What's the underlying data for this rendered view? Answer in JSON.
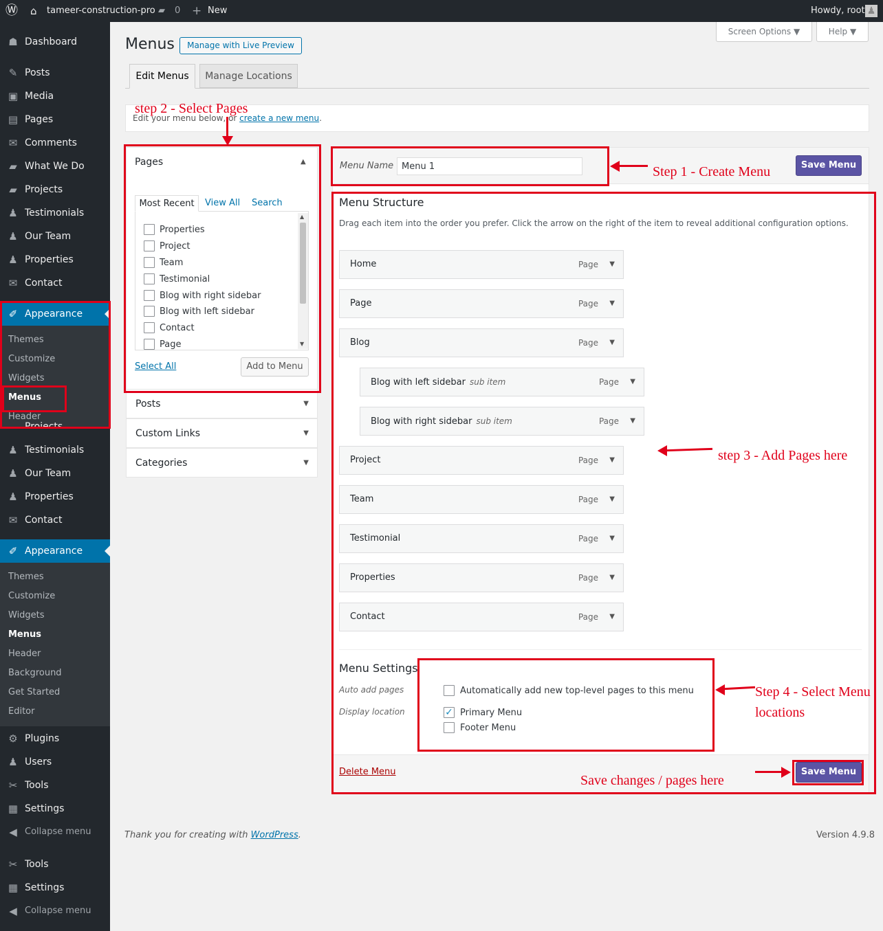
{
  "adminbar": {
    "site": "tameer-construction-pro",
    "comments": "0",
    "new": "New",
    "howdy": "Howdy, root"
  },
  "sidebar": {
    "top": [
      {
        "icon": "☗",
        "label": "Dashboard"
      },
      {
        "icon": "✎",
        "label": "Posts"
      },
      {
        "icon": "▣",
        "label": "Media"
      },
      {
        "icon": "▤",
        "label": "Pages"
      },
      {
        "icon": "✉",
        "label": "Comments"
      },
      {
        "icon": "▰",
        "label": "What We Do"
      },
      {
        "icon": "▰",
        "label": "Projects"
      },
      {
        "icon": "♟",
        "label": "Testimonials"
      },
      {
        "icon": "♟",
        "label": "Our Team"
      },
      {
        "icon": "♟",
        "label": "Properties"
      },
      {
        "icon": "✉",
        "label": "Contact"
      }
    ],
    "appearance1": "Appearance",
    "sub1": [
      "Themes",
      "Customize",
      "Widgets",
      "Menus",
      "Header"
    ],
    "hidden_partial": "Projects",
    "mid": [
      {
        "icon": "♟",
        "label": "Testimonials"
      },
      {
        "icon": "♟",
        "label": "Our Team"
      },
      {
        "icon": "♟",
        "label": "Properties"
      },
      {
        "icon": "✉",
        "label": "Contact"
      }
    ],
    "appearance2": "Appearance",
    "sub2": [
      "Themes",
      "Customize",
      "Widgets",
      "Menus",
      "Header",
      "Background",
      "Get Started",
      "Editor"
    ],
    "bottom": [
      {
        "icon": "⚙",
        "label": "Plugins"
      },
      {
        "icon": "♟",
        "label": "Users"
      },
      {
        "icon": "✂",
        "label": "Tools"
      },
      {
        "icon": "▦",
        "label": "Settings"
      },
      {
        "icon": "◀",
        "label": "Collapse menu"
      }
    ],
    "bottom2": [
      {
        "icon": "✂",
        "label": "Tools"
      },
      {
        "icon": "▦",
        "label": "Settings"
      },
      {
        "icon": "◀",
        "label": "Collapse menu"
      }
    ]
  },
  "header": {
    "title": "Menus",
    "live_preview": "Manage with Live Preview",
    "screen_options": "Screen Options ▼",
    "help": "Help ▼",
    "tab_edit": "Edit Menus",
    "tab_locations": "Manage Locations"
  },
  "notice": {
    "text": "Edit your menu below, or ",
    "link": "create a new menu",
    "end": "."
  },
  "pages_box": {
    "title": "Pages",
    "tabs": [
      "Most Recent",
      "View All",
      "Search"
    ],
    "items": [
      "Properties",
      "Project",
      "Team",
      "Testimonial",
      "Blog with right sidebar",
      "Blog with left sidebar",
      "Contact",
      "Page"
    ],
    "select_all": "Select All",
    "add": "Add to Menu"
  },
  "accordions": [
    "Posts",
    "Custom Links",
    "Categories"
  ],
  "menu_name": {
    "label": "Menu Name",
    "value": "Menu 1"
  },
  "save": "Save Menu",
  "structure": {
    "title": "Menu Structure",
    "desc": "Drag each item into the order you prefer. Click the arrow on the right of the item to reveal additional configuration options.",
    "items": [
      {
        "title": "Home",
        "sub": "",
        "type": "Page"
      },
      {
        "title": "Page",
        "sub": "",
        "type": "Page"
      },
      {
        "title": "Blog",
        "sub": "",
        "type": "Page"
      },
      {
        "title": "Blog with left sidebar",
        "sub": "sub item",
        "type": "Page"
      },
      {
        "title": "Blog with right sidebar",
        "sub": "sub item",
        "type": "Page"
      },
      {
        "title": "Project",
        "sub": "",
        "type": "Page"
      },
      {
        "title": "Team",
        "sub": "",
        "type": "Page"
      },
      {
        "title": "Testimonial",
        "sub": "",
        "type": "Page"
      },
      {
        "title": "Properties",
        "sub": "",
        "type": "Page"
      },
      {
        "title": "Contact",
        "sub": "",
        "type": "Page"
      }
    ]
  },
  "settings": {
    "title": "Menu Settings",
    "auto_label": "Auto add pages",
    "auto_text": "Automatically add new top-level pages to this menu",
    "display_label": "Display location",
    "primary": "Primary Menu",
    "footer": "Footer Menu",
    "primary_checked": true
  },
  "delete": "Delete Menu",
  "annotations": {
    "step1": "Step 1 - Create Menu",
    "step2": "step 2 - Select Pages",
    "step3": "step 3 - Add Pages here",
    "step4a": "Step 4 - Select Menu",
    "step4b": "locations",
    "save": "Save changes / pages here"
  },
  "footer": {
    "thanks": "Thank you for creating with ",
    "wp": "WordPress",
    "dot": ".",
    "version": "Version 4.9.8"
  }
}
